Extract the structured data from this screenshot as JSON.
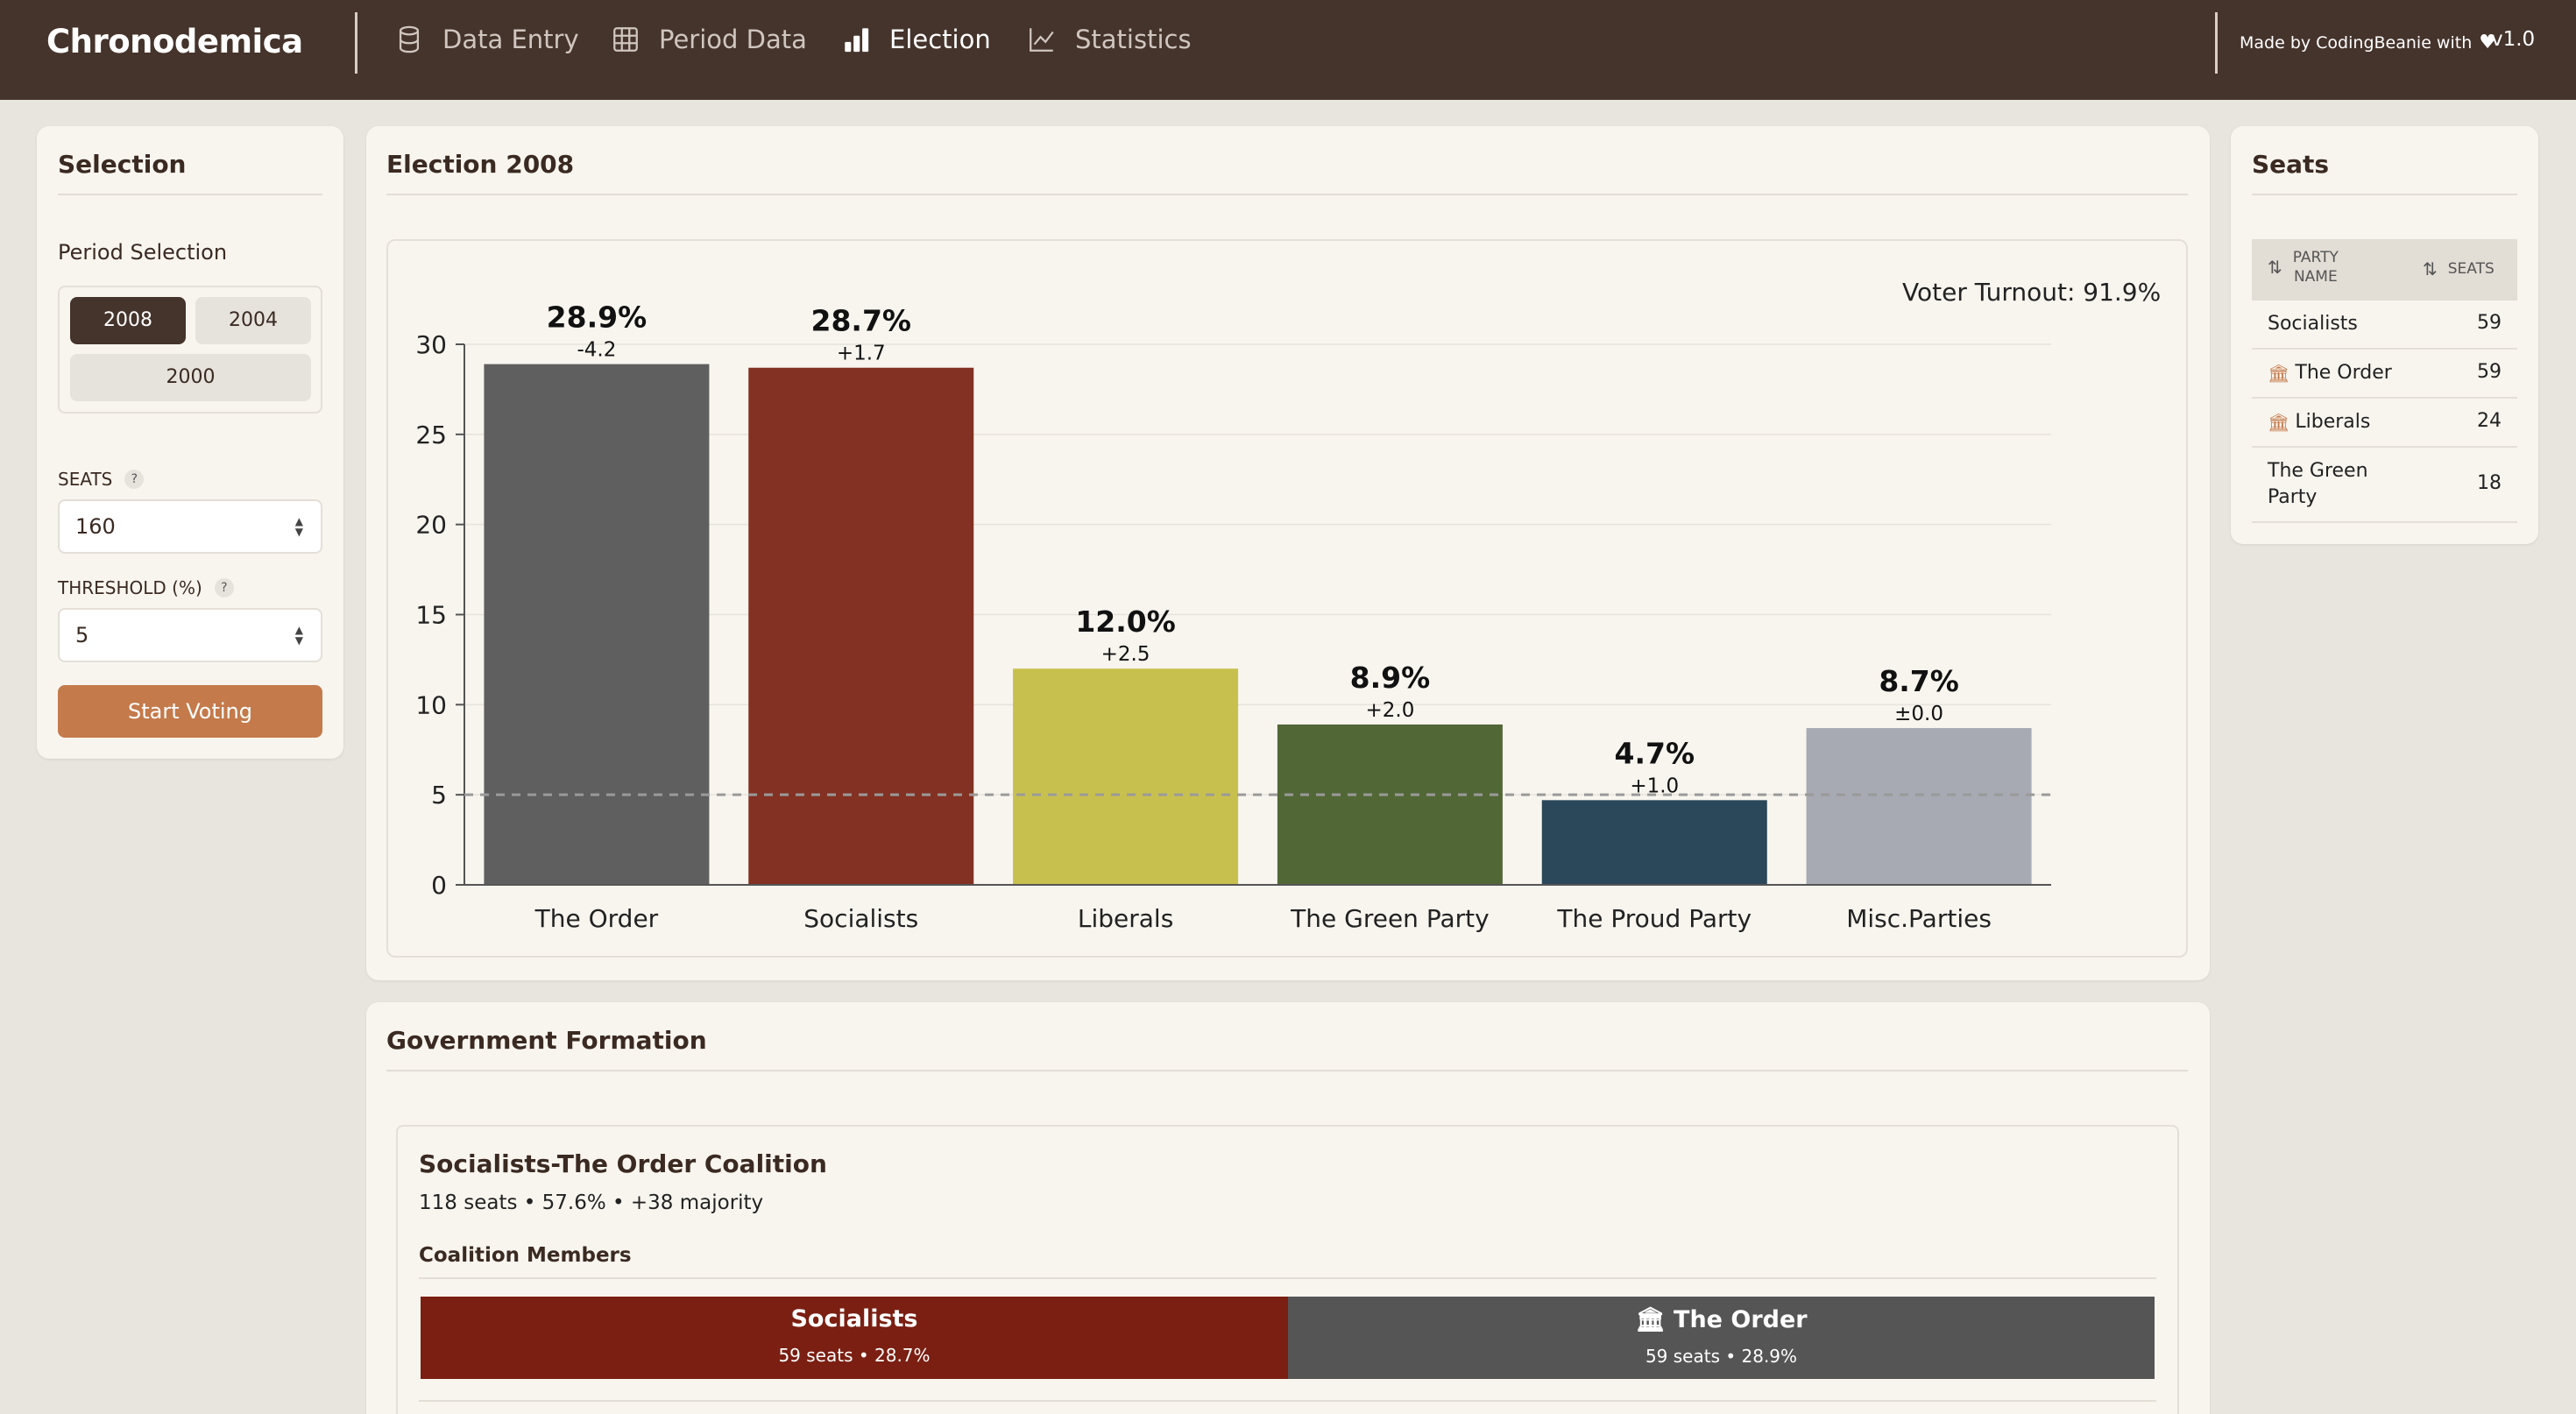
{
  "nav": {
    "brand": "Chronodemica",
    "items": [
      {
        "label": "Data Entry",
        "icon": "database-icon"
      },
      {
        "label": "Period Data",
        "icon": "table-icon"
      },
      {
        "label": "Election",
        "icon": "bar-chart-icon"
      },
      {
        "label": "Statistics",
        "icon": "line-chart-icon"
      }
    ],
    "active": "Election",
    "credit": "Made by CodingBeanie with",
    "version": "v1.0"
  },
  "selection": {
    "title": "Selection",
    "period_label": "Period Selection",
    "periods": [
      "2008",
      "2004",
      "2000"
    ],
    "active_period": "2008",
    "seats_label": "SEATS",
    "seats_value": "160",
    "threshold_label": "THRESHOLD (%)",
    "threshold_value": "5",
    "help_glyph": "?",
    "start_button": "Start Voting"
  },
  "election": {
    "title": "Election 2008",
    "turnout": "Voter Turnout: 91.9%"
  },
  "chart_data": {
    "type": "bar",
    "title": "",
    "xlabel": "",
    "ylabel": "",
    "categories": [
      "The Order",
      "Socialists",
      "Liberals",
      "The Green Party",
      "The Proud Party",
      "Misc.Parties"
    ],
    "values": [
      28.9,
      28.7,
      12.0,
      8.9,
      4.7,
      8.7
    ],
    "value_labels": [
      "28.9%",
      "28.7%",
      "12.0%",
      "8.9%",
      "4.7%",
      "8.7%"
    ],
    "change_labels": [
      "-4.2",
      "+1.7",
      "+2.5",
      "+2.0",
      "+1.0",
      "±0.0"
    ],
    "colors": [
      "#5f5f5f",
      "#833122",
      "#c8c04e",
      "#526736",
      "#2b475a",
      "#a7aab3"
    ],
    "ylim": [
      0,
      30
    ],
    "yticks": [
      0,
      5,
      10,
      15,
      20,
      25,
      30
    ],
    "threshold": 5,
    "grid": true
  },
  "seats": {
    "title": "Seats",
    "col_party": "PARTY NAME",
    "col_party_line1": "PARTY",
    "col_party_line2": "NAME",
    "col_seats": "SEATS",
    "rows": [
      {
        "name": "Socialists",
        "name_line1": "Socialists",
        "name_line2": "",
        "seats": "59",
        "gov": false
      },
      {
        "name": "The Order",
        "name_line1": "The Order",
        "name_line2": "",
        "seats": "59",
        "gov": true
      },
      {
        "name": "Liberals",
        "name_line1": "Liberals",
        "name_line2": "",
        "seats": "24",
        "gov": true
      },
      {
        "name": "The Green Party",
        "name_line1": "The Green",
        "name_line2": "Party",
        "seats": "18",
        "gov": false
      }
    ]
  },
  "government": {
    "title": "Government Formation",
    "coalition_title": "Socialists-The Order Coalition",
    "coalition_summary": "118 seats • 57.6% • +38 majority",
    "members_label": "Coalition Members",
    "members": [
      {
        "name": "Socialists",
        "detail": "59 seats • 28.7%",
        "color": "#7a1f12",
        "gov_icon": false
      },
      {
        "name": "The Order",
        "detail": "59 seats • 28.9%",
        "color": "#555555",
        "gov_icon": true
      }
    ]
  }
}
